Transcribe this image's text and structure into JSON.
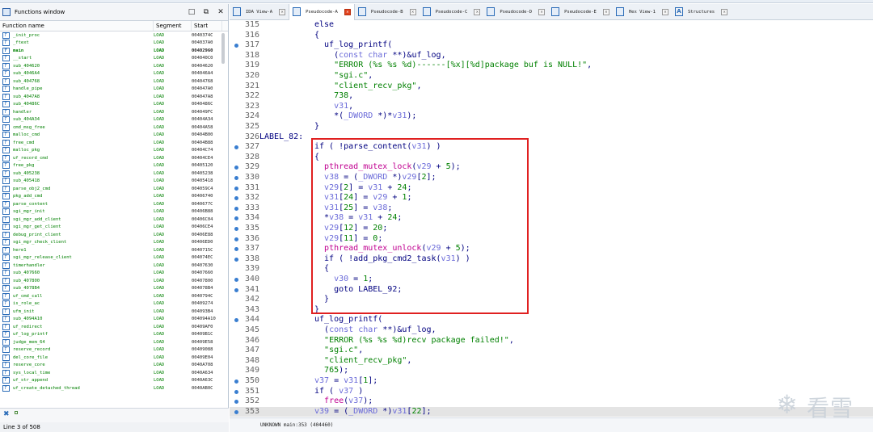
{
  "functions_window": {
    "title": "Functions window",
    "columns": [
      "Function name",
      "Segment",
      "Start"
    ],
    "rows": [
      {
        "name": "_init_proc",
        "segment": "LOAD",
        "start": "0040374C"
      },
      {
        "name": "_ftext",
        "segment": "LOAD",
        "start": "004037A0"
      },
      {
        "name": "main",
        "segment": "LOAD",
        "start": "00402960"
      },
      {
        "name": "__start",
        "segment": "LOAD",
        "start": "004040C0"
      },
      {
        "name": "sub_404620",
        "segment": "LOAD",
        "start": "00404620"
      },
      {
        "name": "sub_4046A4",
        "segment": "LOAD",
        "start": "004046A4"
      },
      {
        "name": "sub_404768",
        "segment": "LOAD",
        "start": "00404768"
      },
      {
        "name": "handle_pipe",
        "segment": "LOAD",
        "start": "004047A0"
      },
      {
        "name": "sub_4047A8",
        "segment": "LOAD",
        "start": "004047A8"
      },
      {
        "name": "sub_40486C",
        "segment": "LOAD",
        "start": "0040486C"
      },
      {
        "name": "handler",
        "segment": "LOAD",
        "start": "004049FC"
      },
      {
        "name": "sub_404A34",
        "segment": "LOAD",
        "start": "00404A34"
      },
      {
        "name": "cmd_msg_free",
        "segment": "LOAD",
        "start": "00404A58"
      },
      {
        "name": "malloc_cmd",
        "segment": "LOAD",
        "start": "00404B00"
      },
      {
        "name": "free_cmd",
        "segment": "LOAD",
        "start": "00404B88"
      },
      {
        "name": "malloc_pkg",
        "segment": "LOAD",
        "start": "00404C74"
      },
      {
        "name": "uf_record_cmd",
        "segment": "LOAD",
        "start": "00404CE4"
      },
      {
        "name": "free_pkg",
        "segment": "LOAD",
        "start": "00405120"
      },
      {
        "name": "sub_405238",
        "segment": "LOAD",
        "start": "00405238"
      },
      {
        "name": "sub_405418",
        "segment": "LOAD",
        "start": "00405418"
      },
      {
        "name": "parse_obj2_cmd",
        "segment": "LOAD",
        "start": "004059C4"
      },
      {
        "name": "pkg_add_cmd",
        "segment": "LOAD",
        "start": "00406740"
      },
      {
        "name": "parse_content",
        "segment": "LOAD",
        "start": "0040677C"
      },
      {
        "name": "sgi_mgr_init",
        "segment": "LOAD",
        "start": "00406B88"
      },
      {
        "name": "sgi_mgr_add_client",
        "segment": "LOAD",
        "start": "00406C04"
      },
      {
        "name": "sgi_mgr_get_client",
        "segment": "LOAD",
        "start": "00406CE4"
      },
      {
        "name": "debug_print_client",
        "segment": "LOAD",
        "start": "00406E88"
      },
      {
        "name": "sgi_mgr_check_client",
        "segment": "LOAD",
        "start": "00406ED0"
      },
      {
        "name": "here1",
        "segment": "LOAD",
        "start": "0040715C"
      },
      {
        "name": "sgi_mgr_release_client",
        "segment": "LOAD",
        "start": "004074EC"
      },
      {
        "name": "timerhandler",
        "segment": "LOAD",
        "start": "00407630"
      },
      {
        "name": "sub_407660",
        "segment": "LOAD",
        "start": "00407660"
      },
      {
        "name": "sub_407800",
        "segment": "LOAD",
        "start": "00407800"
      },
      {
        "name": "sub_4078B4",
        "segment": "LOAD",
        "start": "004078B4"
      },
      {
        "name": "uf_cmd_call",
        "segment": "LOAD",
        "start": "0040794C"
      },
      {
        "name": "is_role_ac",
        "segment": "LOAD",
        "start": "00409274"
      },
      {
        "name": "ufm_init",
        "segment": "LOAD",
        "start": "004093B4"
      },
      {
        "name": "sub_4094A10",
        "segment": "LOAD",
        "start": "004094A10"
      },
      {
        "name": "uf_redirect",
        "segment": "LOAD",
        "start": "00409AF0"
      },
      {
        "name": "uf_log_printf",
        "segment": "LOAD",
        "start": "00409B1C"
      },
      {
        "name": "judge_mem_64",
        "segment": "LOAD",
        "start": "00409E58"
      },
      {
        "name": "reserve_record",
        "segment": "LOAD",
        "start": "00409088"
      },
      {
        "name": "del_core_file",
        "segment": "LOAD",
        "start": "00409E04"
      },
      {
        "name": "reserve_core",
        "segment": "LOAD",
        "start": "0040A708"
      },
      {
        "name": "sys_local_time",
        "segment": "LOAD",
        "start": "0040A634"
      },
      {
        "name": "uf_str_append",
        "segment": "LOAD",
        "start": "0040A63C"
      },
      {
        "name": "uf_create_detached_thread",
        "segment": "LOAD",
        "start": "0040AB0C"
      }
    ],
    "status": "Line 3 of 508"
  },
  "tabs": [
    {
      "label": "IDA View-A",
      "active": false
    },
    {
      "label": "Pseudocode-A",
      "active": true
    },
    {
      "label": "Pseudocode-B",
      "active": false
    },
    {
      "label": "Pseudocode-C",
      "active": false
    },
    {
      "label": "Pseudocode-D",
      "active": false
    },
    {
      "label": "Pseudocode-E",
      "active": false
    },
    {
      "label": "Hex View-1",
      "active": false
    },
    {
      "label": "Structures",
      "active": false
    }
  ],
  "code": {
    "lines": [
      {
        "num": "315",
        "dot": false,
        "label": "",
        "text": "else"
      },
      {
        "num": "316",
        "dot": false,
        "label": "",
        "text": "{"
      },
      {
        "num": "317",
        "dot": true,
        "label": "",
        "text": "  uf_log_printf("
      },
      {
        "num": "318",
        "dot": false,
        "label": "",
        "text": "    (const char **)&uf_log,"
      },
      {
        "num": "319",
        "dot": false,
        "label": "",
        "text": "    \"ERROR (%s %s %d)------[%x][%d]package buf is NULL!\","
      },
      {
        "num": "320",
        "dot": false,
        "label": "",
        "text": "    \"sgi.c\","
      },
      {
        "num": "321",
        "dot": false,
        "label": "",
        "text": "    \"client_recv_pkg\","
      },
      {
        "num": "322",
        "dot": false,
        "label": "",
        "text": "    738,"
      },
      {
        "num": "323",
        "dot": false,
        "label": "",
        "text": "    v31,"
      },
      {
        "num": "324",
        "dot": false,
        "label": "",
        "text": "    *(_DWORD *)*v31);"
      },
      {
        "num": "325",
        "dot": false,
        "label": "",
        "text": "}"
      },
      {
        "num": "326",
        "dot": false,
        "label": "LABEL_82:",
        "text": ""
      },
      {
        "num": "327",
        "dot": true,
        "label": "",
        "text": "if ( !parse_content(v31) )"
      },
      {
        "num": "328",
        "dot": false,
        "label": "",
        "text": "{"
      },
      {
        "num": "329",
        "dot": true,
        "label": "",
        "text": "  pthread_mutex_lock(v29 + 5);"
      },
      {
        "num": "330",
        "dot": true,
        "label": "",
        "text": "  v38 = (_DWORD *)v29[2];"
      },
      {
        "num": "331",
        "dot": true,
        "label": "",
        "text": "  v29[2] = v31 + 24;"
      },
      {
        "num": "332",
        "dot": true,
        "label": "",
        "text": "  v31[24] = v29 + 1;"
      },
      {
        "num": "333",
        "dot": true,
        "label": "",
        "text": "  v31[25] = v38;"
      },
      {
        "num": "334",
        "dot": true,
        "label": "",
        "text": "  *v38 = v31 + 24;"
      },
      {
        "num": "335",
        "dot": true,
        "label": "",
        "text": "  v29[12] = 20;"
      },
      {
        "num": "336",
        "dot": true,
        "label": "",
        "text": "  v29[11] = 0;"
      },
      {
        "num": "337",
        "dot": true,
        "label": "",
        "text": "  pthread_mutex_unlock(v29 + 5);"
      },
      {
        "num": "338",
        "dot": true,
        "label": "",
        "text": "  if ( !add_pkg_cmd2_task(v31) )"
      },
      {
        "num": "339",
        "dot": false,
        "label": "",
        "text": "  {"
      },
      {
        "num": "340",
        "dot": true,
        "label": "",
        "text": "    v30 = 1;"
      },
      {
        "num": "341",
        "dot": true,
        "label": "",
        "text": "    goto LABEL_92;"
      },
      {
        "num": "342",
        "dot": false,
        "label": "",
        "text": "  }"
      },
      {
        "num": "343",
        "dot": false,
        "label": "",
        "text": "}"
      },
      {
        "num": "344",
        "dot": true,
        "label": "",
        "text": "uf_log_printf("
      },
      {
        "num": "345",
        "dot": false,
        "label": "",
        "text": "  (const char **)&uf_log,"
      },
      {
        "num": "346",
        "dot": false,
        "label": "",
        "text": "  \"ERROR (%s %s %d)recv package failed!\","
      },
      {
        "num": "347",
        "dot": false,
        "label": "",
        "text": "  \"sgi.c\","
      },
      {
        "num": "348",
        "dot": false,
        "label": "",
        "text": "  \"client_recv_pkg\","
      },
      {
        "num": "349",
        "dot": false,
        "label": "",
        "text": "  765);"
      },
      {
        "num": "350",
        "dot": true,
        "label": "",
        "text": "v37 = v31[1];"
      },
      {
        "num": "351",
        "dot": true,
        "label": "",
        "text": "if ( v37 )"
      },
      {
        "num": "352",
        "dot": true,
        "label": "",
        "text": "  free(v37);"
      },
      {
        "num": "353",
        "dot": true,
        "label": "",
        "text": "v39 = (_DWORD *)v31[22];",
        "highlight": true
      }
    ],
    "status": "UNKNOWN main:353 (404460)"
  },
  "watermark": {
    "text": "看雪"
  },
  "colors": {
    "accent": "#2b6cb8",
    "highlight_box": "#e02020",
    "keyword": "#000080",
    "string": "#008000",
    "function": "#c00090"
  }
}
